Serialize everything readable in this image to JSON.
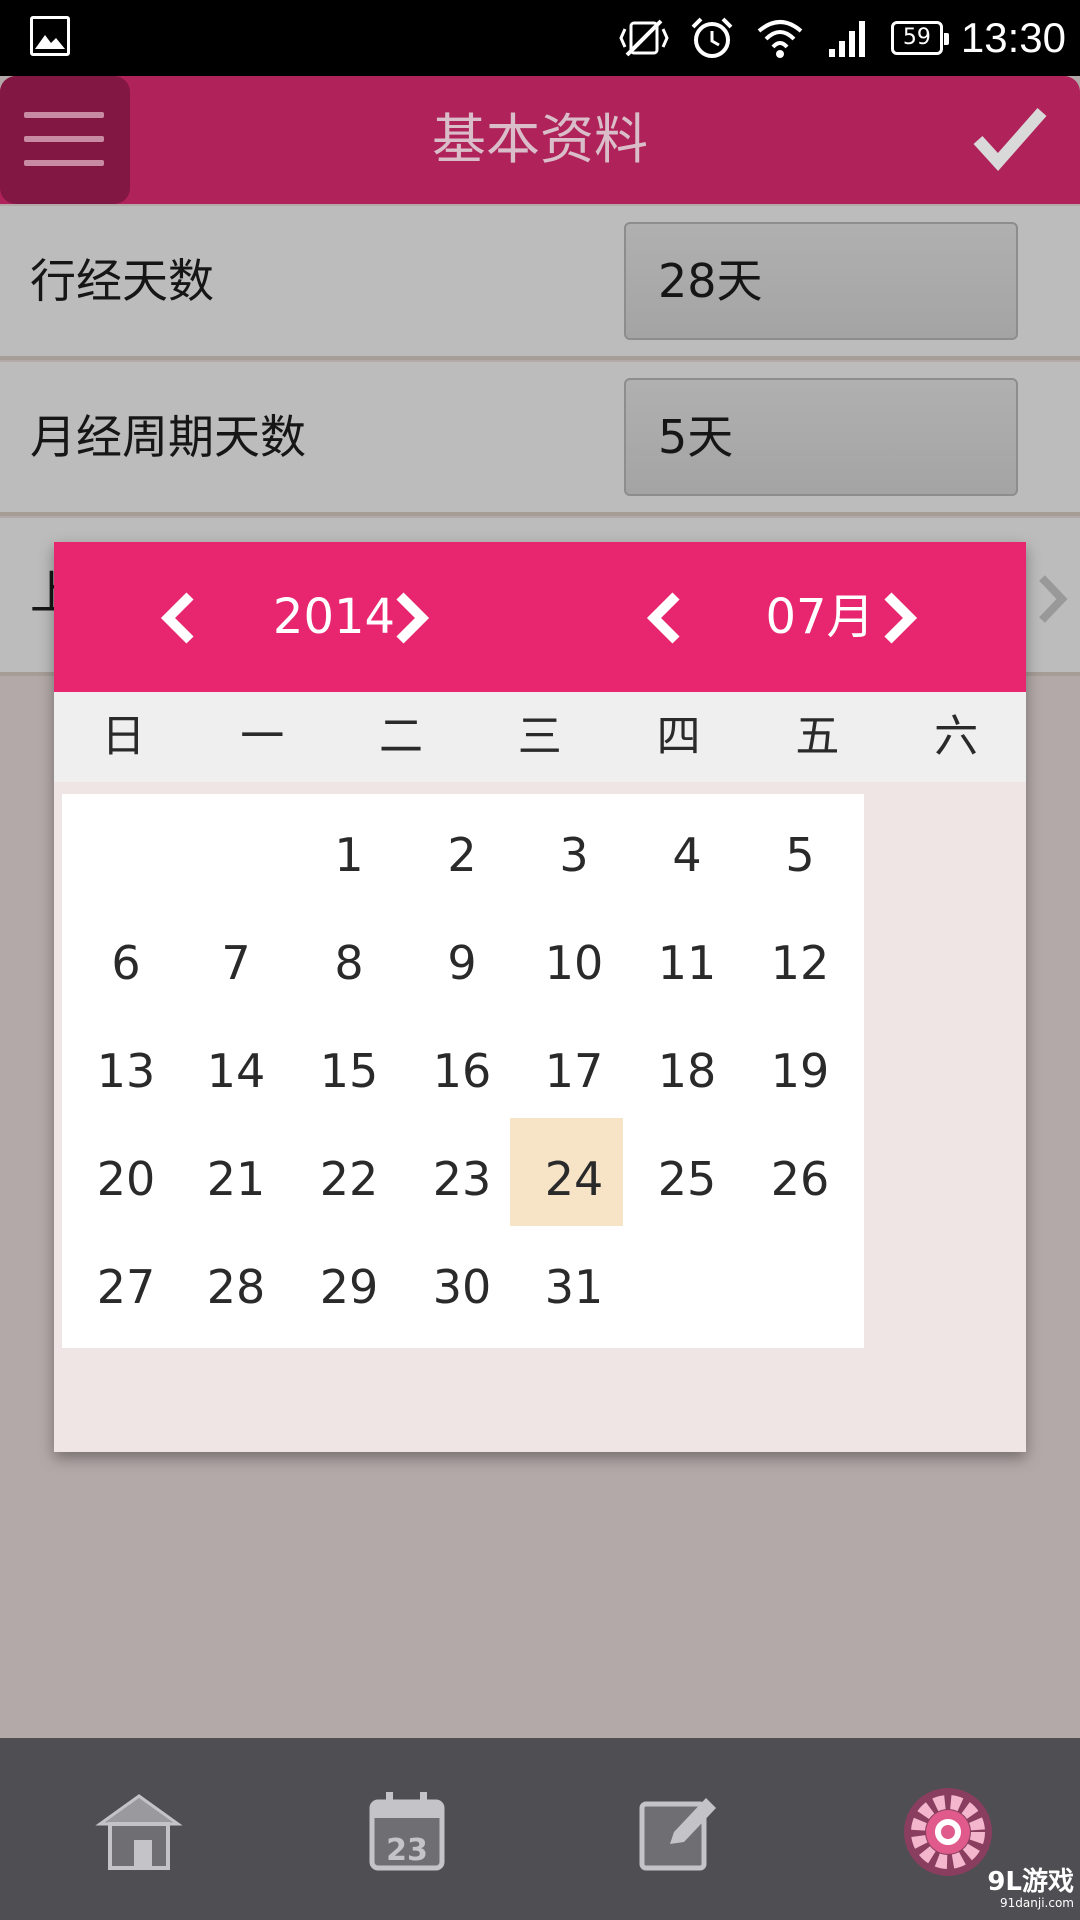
{
  "status_bar": {
    "time": "13:30",
    "battery": "59",
    "icons": [
      "gallery-icon",
      "vibrate-off-icon",
      "alarm-icon",
      "wifi-icon",
      "signal-icon",
      "battery-icon"
    ]
  },
  "app_bar": {
    "title": "基本资料",
    "menu_icon": "hamburger-menu-icon",
    "confirm_icon": "checkmark-icon"
  },
  "form": {
    "rows": [
      {
        "label": "行经天数",
        "value": "28天"
      },
      {
        "label": "月经周期天数",
        "value": "5天"
      },
      {
        "label": "上"
      }
    ]
  },
  "date_picker": {
    "year": "2014",
    "month": "07月",
    "weekdays": [
      "日",
      "一",
      "二",
      "三",
      "四",
      "五",
      "六"
    ],
    "days": [
      [
        "",
        "",
        "1",
        "2",
        "3",
        "4",
        "5"
      ],
      [
        "6",
        "7",
        "8",
        "9",
        "10",
        "11",
        "12"
      ],
      [
        "13",
        "14",
        "15",
        "16",
        "17",
        "18",
        "19"
      ],
      [
        "20",
        "21",
        "22",
        "23",
        "24",
        "25",
        "26"
      ],
      [
        "27",
        "28",
        "29",
        "30",
        "31",
        "",
        ""
      ]
    ],
    "selected_day": "24",
    "colors": {
      "header": "#e8266f",
      "selected": "#f7e4c6"
    }
  },
  "bottom_nav": {
    "items": [
      {
        "icon": "home-icon"
      },
      {
        "icon": "calendar-icon",
        "label": "23"
      },
      {
        "icon": "edit-icon"
      },
      {
        "icon": "settings-icon"
      }
    ]
  },
  "watermark": {
    "main": "9L游戏",
    "sub": "91danji.com"
  }
}
